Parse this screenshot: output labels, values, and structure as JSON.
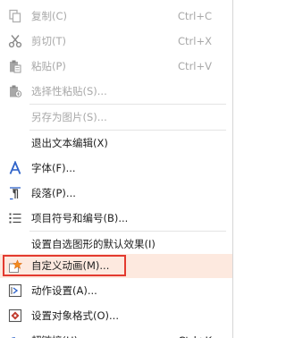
{
  "menu": {
    "items": [
      {
        "id": "copy",
        "label": "复制(C)",
        "shortcut": "Ctrl+C",
        "enabled": false,
        "icon": "copy-icon"
      },
      {
        "id": "cut",
        "label": "剪切(T)",
        "shortcut": "Ctrl+X",
        "enabled": false,
        "icon": "scissors-icon"
      },
      {
        "id": "paste",
        "label": "粘贴(P)",
        "shortcut": "Ctrl+V",
        "enabled": false,
        "icon": "clipboard-icon"
      },
      {
        "id": "paste-special",
        "label": "选择性粘贴(S)...",
        "enabled": false,
        "icon": "paste-special-icon"
      },
      {
        "id": "save-as-picture",
        "label": "另存为图片(S)...",
        "enabled": false,
        "icon": ""
      },
      {
        "id": "exit-text-edit",
        "label": "退出文本编辑(X)",
        "enabled": true,
        "icon": ""
      },
      {
        "id": "font",
        "label": "字体(F)...",
        "enabled": true,
        "icon": "font-a-icon"
      },
      {
        "id": "paragraph",
        "label": "段落(P)...",
        "enabled": true,
        "icon": "paragraph-icon"
      },
      {
        "id": "bullets-numbering",
        "label": "项目符号和编号(B)...",
        "enabled": true,
        "icon": "bullet-list-icon"
      },
      {
        "id": "set-default-effect",
        "label": "设置自选图形的默认效果(I)",
        "enabled": true,
        "icon": ""
      },
      {
        "id": "custom-animation",
        "label": "自定义动画(M)...",
        "enabled": true,
        "icon": "star-animation-icon",
        "highlighted": true
      },
      {
        "id": "action-settings",
        "label": "动作设置(A)...",
        "enabled": true,
        "icon": "action-icon"
      },
      {
        "id": "format-object",
        "label": "设置对象格式(O)...",
        "enabled": true,
        "icon": "format-object-icon"
      },
      {
        "id": "hyperlink-partial",
        "label": "超链接(H)...",
        "shortcut": "Ctrl+K",
        "enabled": true,
        "icon": "link-icon"
      }
    ]
  },
  "colors": {
    "text": "#1f1f1f",
    "disabled_text": "#a8a8a8",
    "highlight_bg": "#fde9df",
    "highlight_border": "#e33a2f",
    "accent_blue": "#2f63c9",
    "icon_gray": "#8a8a8a"
  }
}
